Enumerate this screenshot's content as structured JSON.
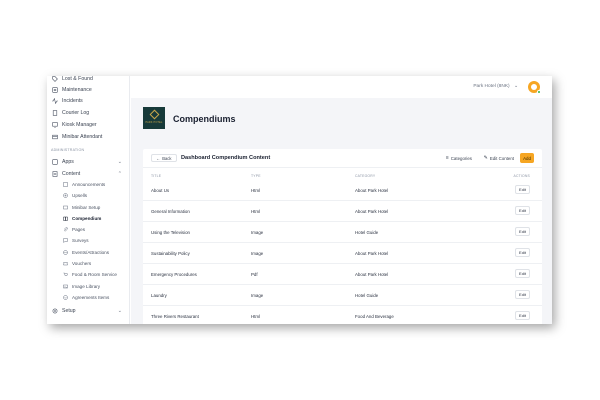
{
  "sidebar": {
    "items_top": [
      {
        "label": "Lost & Found",
        "icon": "tag-icon"
      },
      {
        "label": "Maintenance",
        "icon": "tool-icon"
      },
      {
        "label": "Incidents",
        "icon": "activity-icon"
      },
      {
        "label": "Courier Log",
        "icon": "clipboard-icon"
      },
      {
        "label": "Kiosk Manager",
        "icon": "monitor-icon"
      },
      {
        "label": "Minibar Attendant",
        "icon": "box-icon"
      }
    ],
    "admin_heading": "ADMINISTRATION",
    "apps_label": "Apps",
    "content_label": "Content",
    "content_items": [
      {
        "label": "Announcements",
        "icon": "megaphone-icon"
      },
      {
        "label": "Upsells",
        "icon": "plus-circle-icon"
      },
      {
        "label": "Minibar Setup",
        "icon": "box-icon"
      },
      {
        "label": "Compendium",
        "icon": "book-icon"
      },
      {
        "label": "Pages",
        "icon": "paperclip-icon"
      },
      {
        "label": "Surveys",
        "icon": "message-icon"
      },
      {
        "label": "Events/Attractions",
        "icon": "globe-icon"
      },
      {
        "label": "Vouchers",
        "icon": "ticket-icon"
      },
      {
        "label": "Food & Room Service",
        "icon": "cart-icon"
      },
      {
        "label": "Image Library",
        "icon": "image-icon"
      },
      {
        "label": "Agreements Items",
        "icon": "check-circle-icon"
      }
    ],
    "setup_label": "Setup"
  },
  "topbar": {
    "hotel_select": "Park Hotel (8NK)",
    "hotel_chevron": "⌄"
  },
  "page": {
    "title": "Compendiums",
    "logo_text": "PARK HOTEL"
  },
  "card": {
    "back_label": "Back",
    "title": "Dashboard Compendium Content",
    "categories_label": "Categories",
    "edit_content_label": "Edit Content",
    "add_label": "Add"
  },
  "table": {
    "columns": [
      "TITLE",
      "TYPE",
      "CATEGORY",
      "ACTIONS"
    ],
    "edit_label": "Edit",
    "rows": [
      {
        "title": "About Us",
        "type": "Html",
        "category": "About Park Hotel"
      },
      {
        "title": "General Information",
        "type": "Html",
        "category": "About Park Hotel"
      },
      {
        "title": "Using the Television",
        "type": "Image",
        "category": "Hotel Guide"
      },
      {
        "title": "Sustainability Policy",
        "type": "Image",
        "category": "About Park Hotel"
      },
      {
        "title": "Emergency Procedures",
        "type": "Pdf",
        "category": "About Park Hotel"
      },
      {
        "title": "Laundry",
        "type": "Image",
        "category": "Hotel Guide"
      },
      {
        "title": "Three Rivers Restaurant",
        "type": "Html",
        "category": "Food And Beverage"
      }
    ]
  },
  "colors": {
    "accent": "#f6a623",
    "logo_bg": "#173a3a",
    "status_online": "#2fb344"
  }
}
